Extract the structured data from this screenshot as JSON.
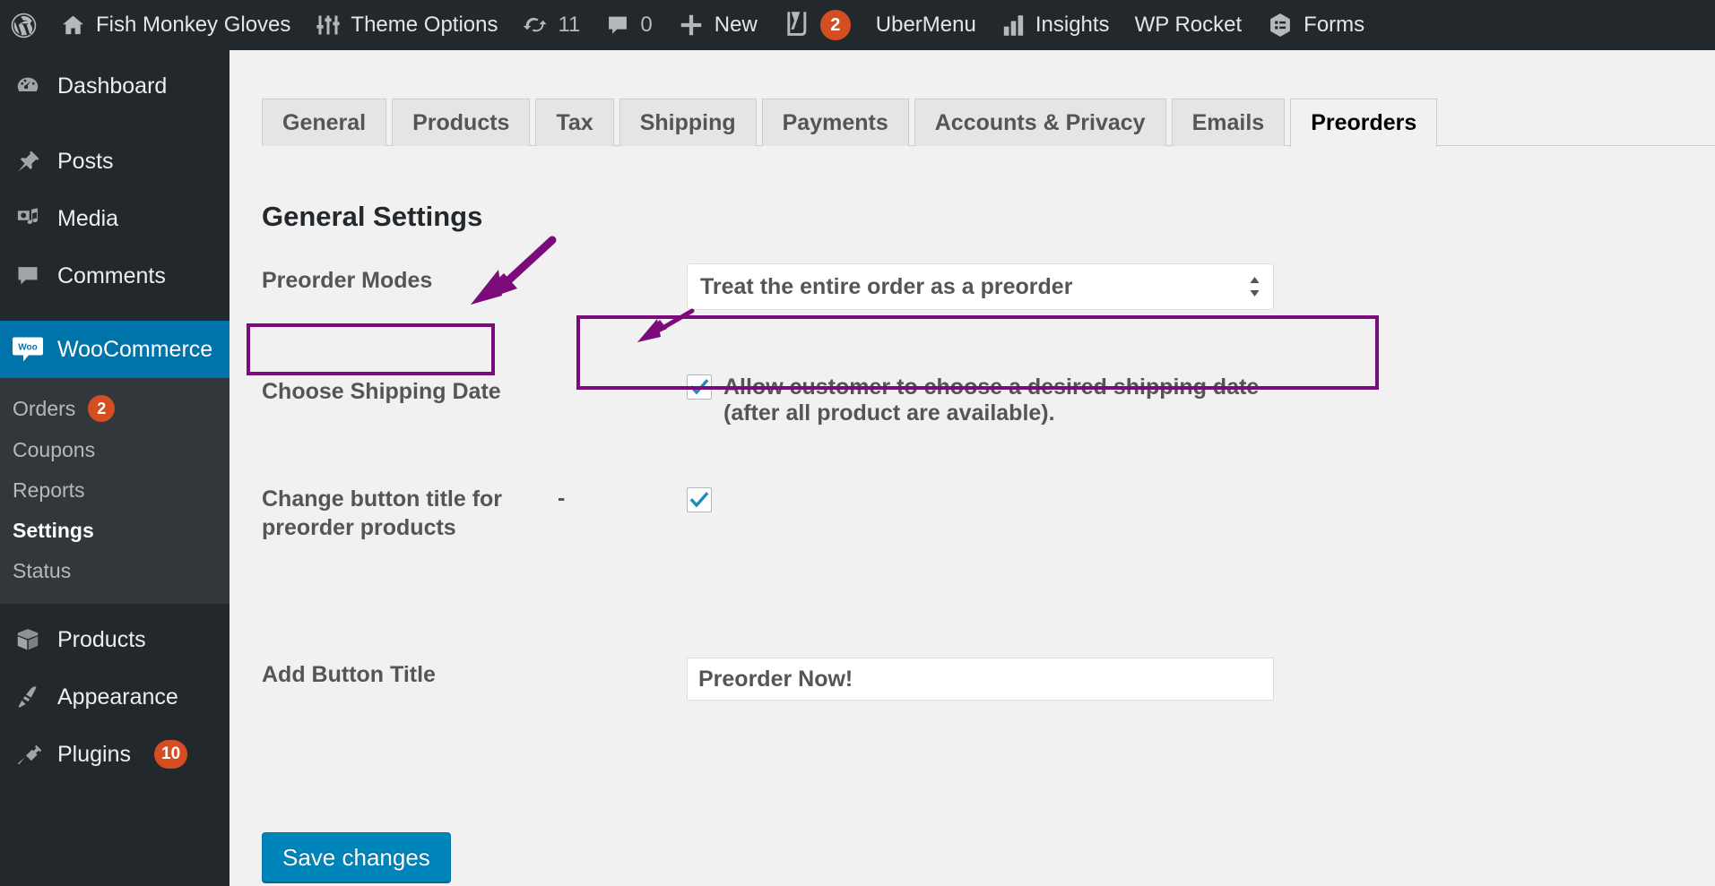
{
  "adminbar": {
    "items": [
      {
        "name": "wp-logo",
        "icon": "wordpress-icon",
        "label": ""
      },
      {
        "name": "site-name",
        "icon": "home-icon",
        "label": "Fish Monkey Gloves"
      },
      {
        "name": "theme-options",
        "icon": "sliders-icon",
        "label": "Theme Options"
      },
      {
        "name": "updates",
        "icon": "updates-icon",
        "label": "11"
      },
      {
        "name": "comments",
        "icon": "comment-bubble-icon",
        "label": "0"
      },
      {
        "name": "new-content",
        "icon": "plus-icon",
        "label": "New"
      },
      {
        "name": "yoast-seo",
        "icon": "yoast-icon",
        "label": "",
        "badge": "2"
      },
      {
        "name": "ubermenu",
        "icon": "",
        "label": "UberMenu"
      },
      {
        "name": "insights",
        "icon": "bar-chart-icon",
        "label": "Insights"
      },
      {
        "name": "wp-rocket",
        "icon": "",
        "label": "WP Rocket"
      },
      {
        "name": "forms",
        "icon": "forms-icon",
        "label": "Forms"
      }
    ]
  },
  "sidebar": {
    "items": [
      {
        "label": "Dashboard",
        "icon": "dashboard-icon",
        "current": false
      },
      {
        "label": "Posts",
        "icon": "pin-icon",
        "current": false
      },
      {
        "label": "Media",
        "icon": "media-icon",
        "current": false
      },
      {
        "label": "Comments",
        "icon": "comment-icon",
        "current": false
      },
      {
        "label": "WooCommerce",
        "icon": "woo-icon",
        "current": true
      }
    ],
    "submenu": [
      {
        "label": "Orders",
        "badge": "2",
        "current": false
      },
      {
        "label": "Coupons",
        "badge": "",
        "current": false
      },
      {
        "label": "Reports",
        "badge": "",
        "current": false
      },
      {
        "label": "Settings",
        "badge": "",
        "current": true
      },
      {
        "label": "Status",
        "badge": "",
        "current": false
      }
    ],
    "items_bottom": [
      {
        "label": "Products",
        "icon": "products-icon",
        "badge": ""
      },
      {
        "label": "Appearance",
        "icon": "appearance-icon",
        "badge": ""
      },
      {
        "label": "Plugins",
        "icon": "plugins-icon",
        "badge": "10"
      }
    ]
  },
  "tabs": [
    {
      "label": "General",
      "active": false
    },
    {
      "label": "Products",
      "active": false
    },
    {
      "label": "Tax",
      "active": false
    },
    {
      "label": "Shipping",
      "active": false
    },
    {
      "label": "Payments",
      "active": false
    },
    {
      "label": "Accounts & Privacy",
      "active": false
    },
    {
      "label": "Emails",
      "active": false
    },
    {
      "label": "Preorders",
      "active": true
    }
  ],
  "page": {
    "title": "General Settings",
    "save_label": "Save changes"
  },
  "form": {
    "preorder_modes": {
      "label": "Preorder Modes",
      "value": "Treat the entire order as a preorder",
      "options": [
        "Treat the entire order as a preorder"
      ]
    },
    "choose_shipping_date": {
      "label": "Choose Shipping Date",
      "checkbox_label_line1": "Allow customer to choose a desired shipping date",
      "checkbox_label_line2": "(after all product are available).",
      "checked": true
    },
    "change_button_title": {
      "label": "Change button title for preorder products",
      "dash": "-",
      "checked": true
    },
    "add_button_title": {
      "label": "Add Button Title",
      "value": "Preorder Now!",
      "placeholder": "Preorder Now!"
    }
  },
  "annotations": {
    "highlight_color": "#7b0a7b",
    "boxes": [
      {
        "name": "choose-shipping-date-highlight"
      },
      {
        "name": "allow-customer-checkbox-highlight"
      }
    ],
    "arrows": [
      {
        "name": "arrow-to-choose-shipping-date"
      },
      {
        "name": "arrow-to-allow-customer-checkbox"
      }
    ]
  },
  "colors": {
    "wp_blue": "#0073aa",
    "button_blue": "#0085ba",
    "badge_orange": "#d54e21",
    "annotation_purple": "#7b0a7b",
    "checkbox_blue": "#1e8cbe"
  }
}
